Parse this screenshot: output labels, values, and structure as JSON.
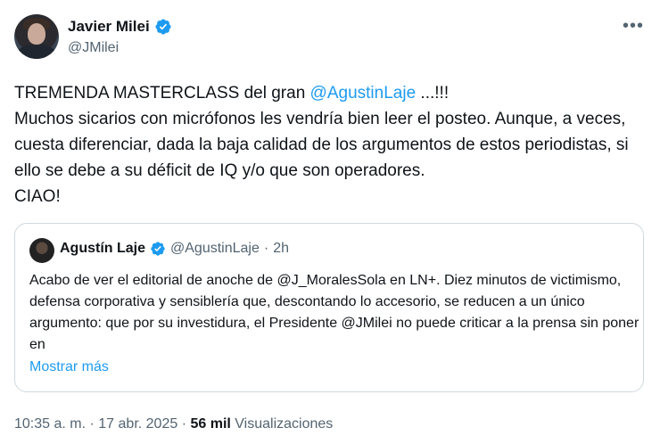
{
  "author": {
    "name": "Javier Milei",
    "handle": "@JMilei"
  },
  "tweet": {
    "line1_text": "TREMENDA MASTERCLASS del gran ",
    "line1_mention": "@AgustinLaje",
    "line1_tail": " ...!!!",
    "body": "Muchos sicarios con micrófonos les vendría bien leer el posteo. Aunque, a veces, cuesta diferenciar, dada la baja calidad de los argumentos de estos periodistas, si ello se debe a su déficit de IQ y/o que son operadores.",
    "closing": "CIAO!"
  },
  "quote": {
    "name": "Agustín Laje",
    "handle": "@AgustinLaje",
    "separator": "·",
    "time": "2h",
    "text": "Acabo de ver el editorial de anoche de @J_MoralesSola en LN+. Diez minutos de victimismo, defensa corporativa y sensiblería que, descontando lo accesorio, se reducen a un único argumento: que por su investidura, el Presidente @JMilei no puede criticar a la prensa sin poner en",
    "show_more": "Mostrar más"
  },
  "meta": {
    "time": "10:35 a. m.",
    "separator": "·",
    "date": "17 abr. 2025",
    "views_count": "56 mil",
    "views_label": "Visualizaciones"
  },
  "icons": {
    "verified": "verified-badge-icon",
    "more": "more-options-icon"
  },
  "colors": {
    "accent": "#1d9bf0",
    "secondary_text": "#536471",
    "border": "#cfd9de"
  }
}
